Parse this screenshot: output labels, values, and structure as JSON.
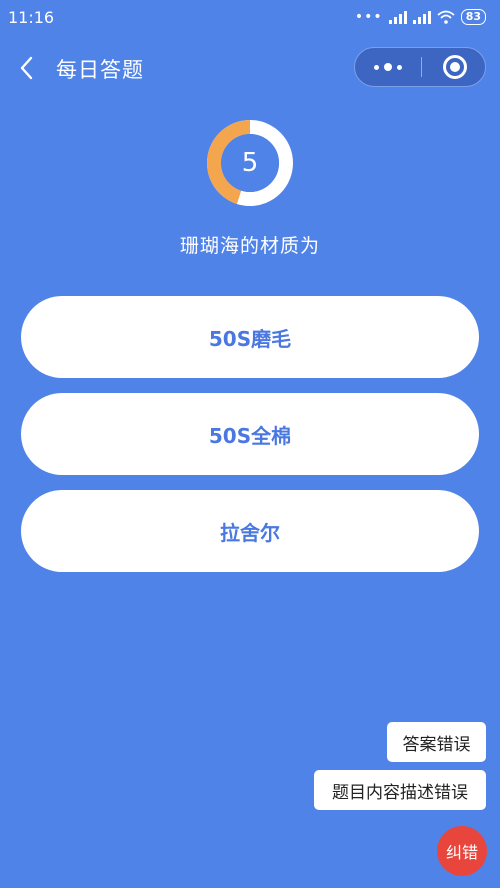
{
  "status_bar": {
    "time": "11:16",
    "more": "•••",
    "battery": "83",
    "icons": [
      "signal-icon",
      "signal-icon",
      "wifi-icon",
      "battery-icon"
    ]
  },
  "nav": {
    "title": "每日答题",
    "back_icon": "chevron-left-icon",
    "more_icon": "more-dots-icon",
    "close_icon": "target-icon"
  },
  "timer": {
    "count": "5",
    "progress_fraction": 0.45,
    "progress_color": "#f3a64e",
    "track_color": "#ffffff"
  },
  "question": {
    "text": "珊瑚海的材质为"
  },
  "options": [
    {
      "label": "50S磨毛"
    },
    {
      "label": "50S全棉"
    },
    {
      "label": "拉舍尔"
    }
  ],
  "feedback": {
    "answer_error": "答案错误",
    "content_error": "题目内容描述错误",
    "correct_button": "纠错"
  },
  "colors": {
    "background": "#5083e8",
    "option_text": "#4a78e0",
    "fab": "#e8453c"
  }
}
